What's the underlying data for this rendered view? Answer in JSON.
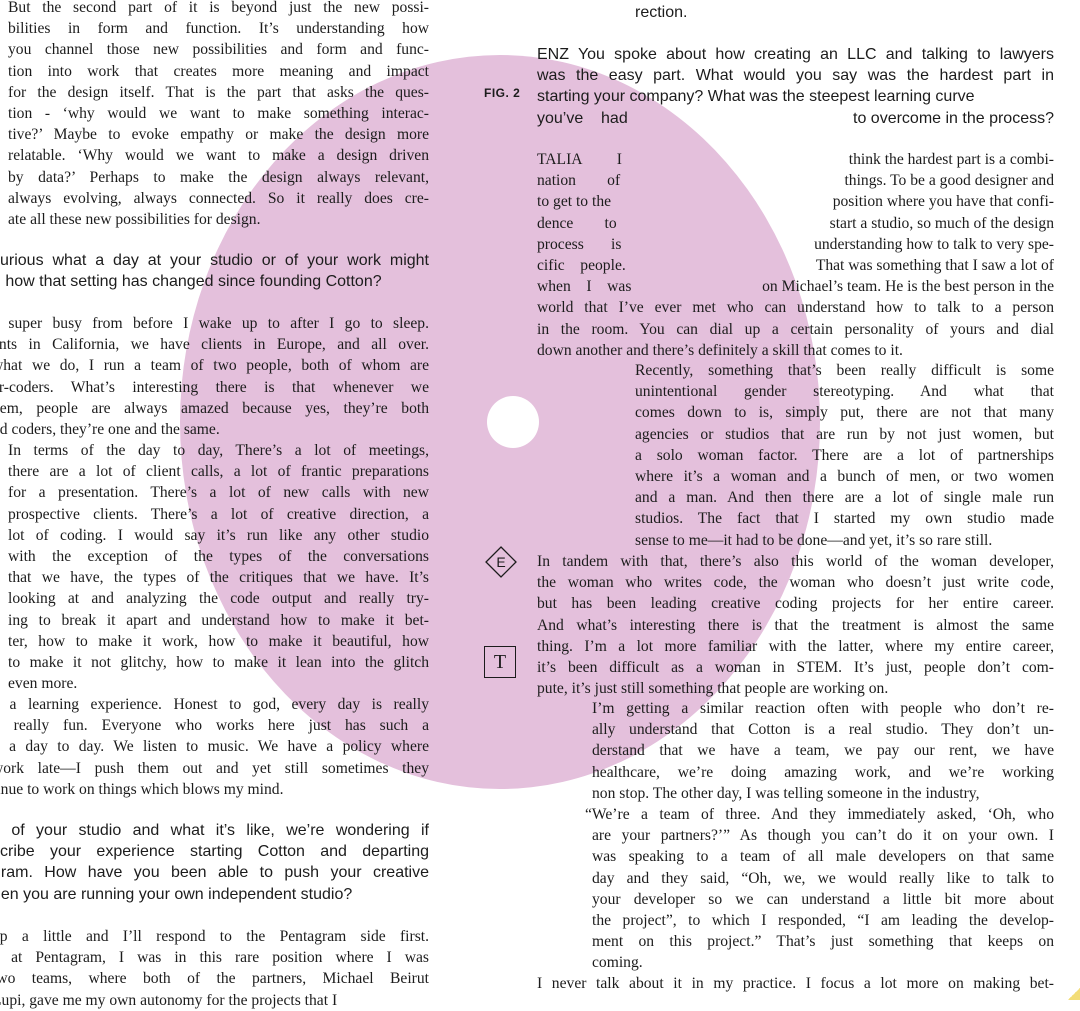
{
  "left": {
    "intro_lines": [
      "But the second part of it is beyond just the new possi-",
      "bilities in form and function. It’s understanding how",
      "you channel those new possibilities and form and func-",
      "tion into work that creates more meaning and impact",
      "for the design itself. That is the part that asks the ques-",
      "tion - ‘why would we want to make something interac-",
      "tive?’ Maybe to evoke empathy or make the design more",
      "relatable. ‘Why would we want to make a design driven",
      "by data?’ Perhaps to make the design always relevant,",
      "always evolving, always connected. So it really does cre-",
      "ate all these new possibilities for design."
    ],
    "q1_lines": [
      "curious what a day at your studio or of your work might",
      "d how that setting has changed since founding Cotton?"
    ],
    "a1_lines": [
      "s super busy from before I wake up to after I go to sleep.",
      "ents in California, we have clients in Europe, and all over.",
      "what we do, I run a team of two people, both of whom are",
      "er-coders. What’s interesting there is that whenever we",
      "hem, people are always amazed because yes, they’re both",
      "nd coders, they’re one and the same."
    ],
    "a1_indent_lines": [
      "In terms of the day to day, There’s a lot of meetings,",
      "there are a lot of client calls, a lot of frantic preparations",
      "for a presentation. There’s a lot of new calls with new",
      "prospective clients. There’s a lot of creative direction, a",
      "lot of coding. I would say it’s run like any other studio",
      "with the exception of the types of the conversations",
      "that we have, the types of the critiques that we have. It’s",
      "looking at and analyzing the code output and really try-",
      "ing to break it apart and understand how to make it bet-",
      "ter, how to make it work, how to make it beautiful, how",
      "to make it not glitchy, how to make it lean into the glitch",
      "even more."
    ],
    "a1_tail_lines": [
      "s a learning experience. Honest to god, every day is really",
      "d really fun. Everyone who works here just has such a",
      "n a day to day. We listen to music. We have a policy where",
      "work late—I push them out and yet still sometimes they",
      "tinue to work on things which blows my mind."
    ],
    "q2_lines": [
      "c of your studio and what it’s like, we’re wondering if",
      "scribe your experience starting Cotton and departing",
      "gram. How have you been able to push your creative",
      "hen you are running your own independent studio?"
    ],
    "a2_lines": [
      "up a little and I’ll respond to the Pentagram side first.",
      "s at Pentagram, I was in this rare position where I was",
      "two teams, where both of the partners, Michael Beirut",
      "Lupi, gave me my own autonomy for the projects that I"
    ]
  },
  "right": {
    "top_fragment": "rection.",
    "q_lines": [
      "ENZ You spoke about how creating an LLC and talking to lawyers",
      "was the easy part. What would you say was the hardest part in",
      "starting your company? What was the steepest learning curve"
    ],
    "q_last_left": "you’ve    had",
    "q_last_right": "to overcome in the process?",
    "talia_pairs": [
      [
        "TALIA         I",
        "think the hardest part is a combi-"
      ],
      [
        "nation        of",
        "things. To be a good designer and"
      ],
      [
        "to get to the",
        "position where you have that confi-"
      ],
      [
        "dence        to",
        "start a studio, so much of the design"
      ],
      [
        "process       is",
        "understanding how to talk to very spe-"
      ],
      [
        "cific    people.",
        "That was something that I saw a lot of"
      ],
      [
        "when    I    was",
        "on Michael’s team. He is the best person in the"
      ]
    ],
    "talia_full_lines": [
      "world that I’ve ever met who can understand how to talk to a person",
      "in the room. You can dial up a certain personality of yours and dial",
      "down another and there’s definitely a skill that comes to it."
    ],
    "recent_lines": [
      "Recently, something that’s been really difficult is some",
      "unintentional gender stereotyping. And what that",
      "comes down to is, simply put, there are not that many",
      "agencies or  studios that are run by not just women, but",
      "a solo woman factor. There are a lot of partnerships",
      "where it’s a woman and a bunch of men, or two women",
      "and a man. And then there  are a lot of single male run",
      "studios. The fact that I started my own studio made",
      "sense to me—it had to be done—and yet, it’s so rare still."
    ],
    "tandem_lines": [
      "In tandem with that, there’s also this world of the woman developer,",
      "the woman who writes code, the woman who doesn’t just write code,",
      "but has been leading creative coding projects for her entire career.",
      "And what’s interesting there is that the treatment is almost the same",
      "thing. I’m a lot more familiar with the latter, where my entire career,",
      "it’s been difficult as a woman in STEM. It’s just, people don’t com-",
      "pute, it’s just still something that people are working on."
    ],
    "similar_lines": [
      "I’m getting a similar reaction often with people who don’t re-",
      "ally understand that Cotton is a real studio. They don’t un-",
      "derstand that we have a team, we pay our rent, we have",
      "healthcare, we’re doing amazing work, and we’re working",
      "non stop. The other day, I was telling someone in the industry,"
    ],
    "quote_line": "“We’re a team of three. And they immediately asked, ‘Oh, who",
    "similar_tail_lines": [
      "are your partners?’” As though you can’t do it on your own. I",
      "was speaking to a team of all male developers on that same",
      "day and they said, “Oh, we, we would really like to talk to",
      "your developer so we can understand a little bit more about",
      "the project”, to which I responded, “I am leading the develop-",
      "ment on this project.” That’s just something that keeps on",
      "coming."
    ],
    "final_line": "I never talk about it in my practice. I focus a lot more on making bet-"
  },
  "figure_label": "FIG. 2",
  "diamond_letter": "E",
  "box_letter": "T",
  "colors": {
    "disc": "#e4c0dc",
    "text": "#1c1c1c",
    "background": "#ffffff",
    "corner_accent": "#f3dd77"
  }
}
